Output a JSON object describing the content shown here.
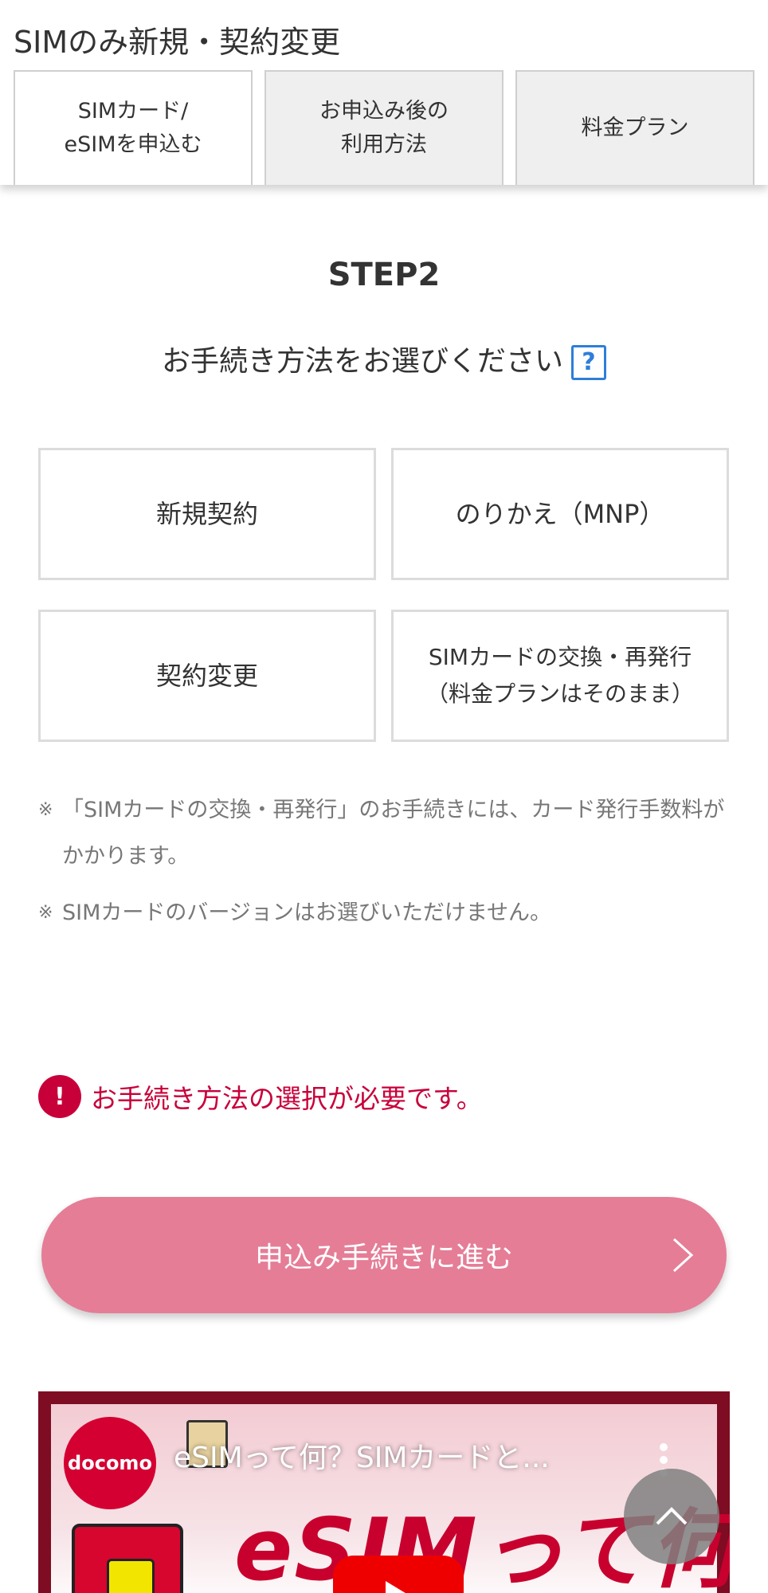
{
  "page_title": "SIMのみ新規・契約変更",
  "tabs": [
    {
      "label": "SIMカード/\neSIMを申込む",
      "active": true
    },
    {
      "label": "お申込み後の\n利用方法",
      "active": false
    },
    {
      "label": "料金プラン",
      "active": false
    }
  ],
  "step": {
    "title": "STEP2",
    "question": "お手続き方法をお選びください",
    "help_icon": "question-icon",
    "help_label": "?"
  },
  "options": [
    {
      "label": "新規契約"
    },
    {
      "label": "のりかえ（MNP）"
    },
    {
      "label": "契約変更"
    },
    {
      "label": "SIMカードの交換・再発行\n（料金プランはそのまま）"
    }
  ],
  "notes": [
    {
      "mark": "※",
      "text": "「SIMカードの交換・再発行」のお手続きには、カード発行手数料がかかります。"
    },
    {
      "mark": "※",
      "text": "SIMカードのバージョンはお選びいただけません。"
    }
  ],
  "error": {
    "icon": "exclamation-icon",
    "icon_label": "!",
    "text": "お手続き方法の選択が必要です。"
  },
  "proceed_button": {
    "label": "申込み手続きに進む",
    "icon": "chevron-right-icon"
  },
  "video": {
    "logo": "docomo",
    "title": "eSIMって何？SIMカードと...",
    "thumbnail_text": "eSIMって何",
    "menu_icon": "more-vert-icon",
    "play_icon": "youtube-play-icon"
  },
  "scroll_top_icon": "chevron-up-icon",
  "colors": {
    "accent_red": "#c8003a",
    "proceed_button": "#e57d96",
    "help_blue": "#2f7ed8"
  }
}
